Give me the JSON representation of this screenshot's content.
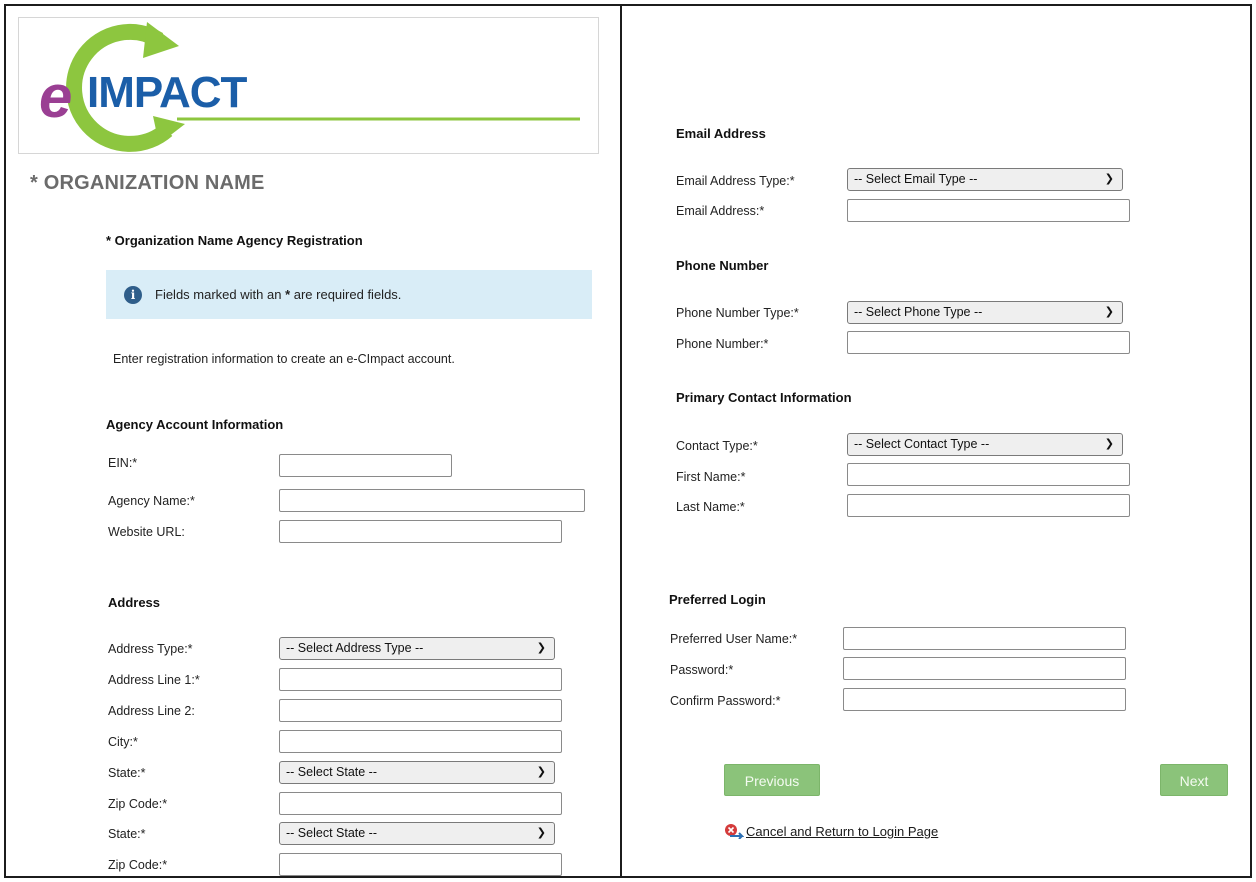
{
  "logo": {
    "e": "e",
    "text": "IMPACT"
  },
  "page_title": "* ORGANIZATION NAME",
  "registration_title": "* Organization Name Agency Registration",
  "info": {
    "before": "Fields marked with an ",
    "star": "*",
    "after": " are required fields.",
    "icon": "info-icon"
  },
  "intro": "Enter registration information to create an e-CImpact account.",
  "agency": {
    "heading": "Agency Account Information",
    "ein_label": "EIN:*",
    "name_label": "Agency Name:*",
    "website_label": "Website URL:"
  },
  "address": {
    "heading": "Address",
    "type_label": "Address Type:*",
    "type_value": "-- Select Address Type --",
    "line1_label": "Address Line 1:*",
    "line2_label": "Address Line 2:",
    "city_label": "City:*",
    "state_label": "State:*",
    "state_value": "-- Select State --",
    "zip_label": "Zip Code:*",
    "state2_label": "State:*",
    "state2_value": "-- Select State --",
    "zip2_label": "Zip Code:*"
  },
  "email": {
    "heading": "Email Address",
    "type_label": "Email Address Type:*",
    "type_value": "-- Select Email Type --",
    "address_label": "Email Address:*"
  },
  "phone": {
    "heading": "Phone Number",
    "type_label": "Phone Number Type:*",
    "type_value": "-- Select Phone Type --",
    "number_label": "Phone Number:*"
  },
  "contact": {
    "heading": "Primary Contact Information",
    "type_label": "Contact Type:*",
    "type_value": "-- Select Contact Type --",
    "first_label": "First Name:*",
    "last_label": "Last Name:*"
  },
  "login": {
    "heading": "Preferred Login",
    "user_label": "Preferred User Name:*",
    "password_label": "Password:*",
    "confirm_label": "Confirm Password:*"
  },
  "buttons": {
    "previous": "Previous",
    "next": "Next"
  },
  "cancel_link": "Cancel and Return to Login Page",
  "colors": {
    "logo_purple": "#9a3f93",
    "logo_blue": "#1b5ea8",
    "logo_green": "#8dc63f",
    "button_green": "#8bc37a",
    "info_bg": "#d9edf7"
  }
}
